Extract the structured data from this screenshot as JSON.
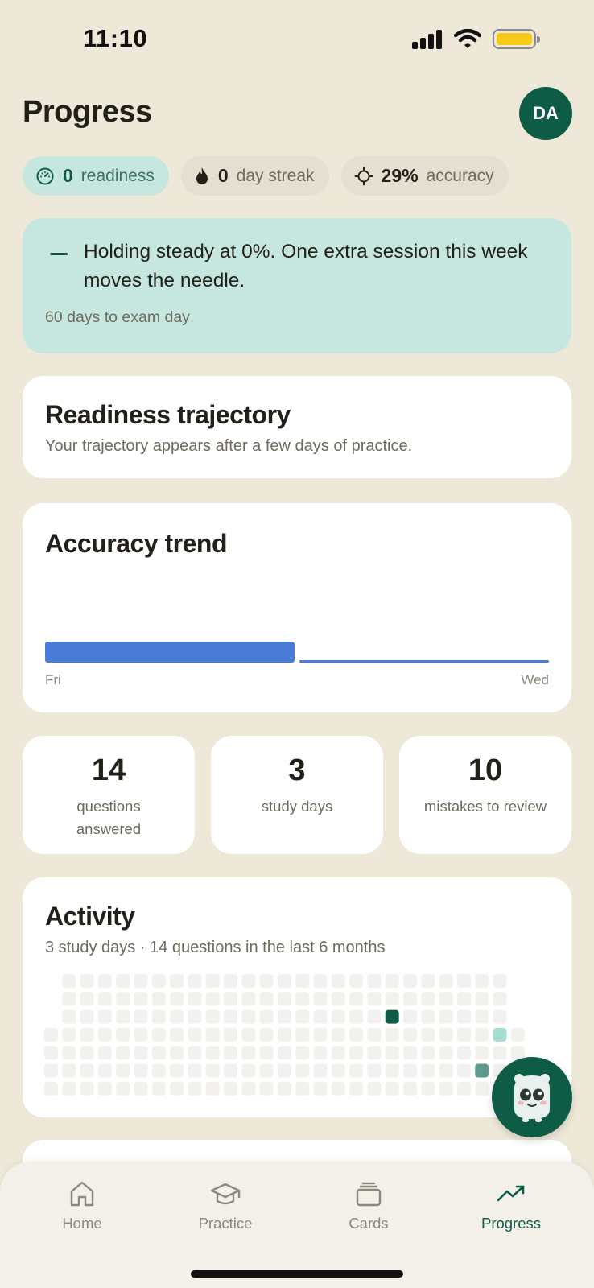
{
  "status_bar": {
    "time": "11:10"
  },
  "header": {
    "title": "Progress",
    "avatar_initials": "DA"
  },
  "pills": [
    {
      "icon": "gauge-icon",
      "value": "0",
      "label": "readiness"
    },
    {
      "icon": "flame-icon",
      "value": "0",
      "label": "day streak"
    },
    {
      "icon": "crosshair-icon",
      "value": "29%",
      "label": "accuracy"
    }
  ],
  "insight": {
    "message": "Holding steady at 0%. One extra session this week moves the needle.",
    "countdown": "60 days to exam day"
  },
  "trajectory": {
    "title": "Readiness trajectory",
    "subtitle": "Your trajectory appears after a few days of practice."
  },
  "accuracy_trend": {
    "title": "Accuracy trend",
    "start_label": "Fri",
    "end_label": "Wed"
  },
  "chart_data": {
    "type": "bar",
    "title": "Accuracy trend",
    "x": [
      "Fri",
      "Wed"
    ],
    "series": [
      {
        "values": [
          1,
          0.1
        ]
      }
    ],
    "color": "#4A7BD6"
  },
  "stats": [
    {
      "value": "14",
      "label": "questions answered"
    },
    {
      "value": "3",
      "label": "study days"
    },
    {
      "value": "10",
      "label": "mistakes to review"
    }
  ],
  "activity": {
    "title": "Activity",
    "subtitle": "3 study days · 14 questions in the last 6 months",
    "active_cells": [
      {
        "col": 19,
        "row": 2,
        "level": 3
      },
      {
        "col": 25,
        "row": 3,
        "level": 1
      },
      {
        "col": 24,
        "row": 5,
        "level": 2
      }
    ],
    "colors": {
      "empty": "#F2F1EE",
      "level1": "#A6DDCF",
      "level2": "#5E9B8C",
      "level3": "#0E5C46"
    }
  },
  "tabs": [
    {
      "label": "Home",
      "icon": "home-icon"
    },
    {
      "label": "Practice",
      "icon": "graduation-cap-icon"
    },
    {
      "label": "Cards",
      "icon": "cards-stack-icon"
    },
    {
      "label": "Progress",
      "icon": "trending-up-icon",
      "active": true
    }
  ],
  "accent_color": "#0E5C46"
}
